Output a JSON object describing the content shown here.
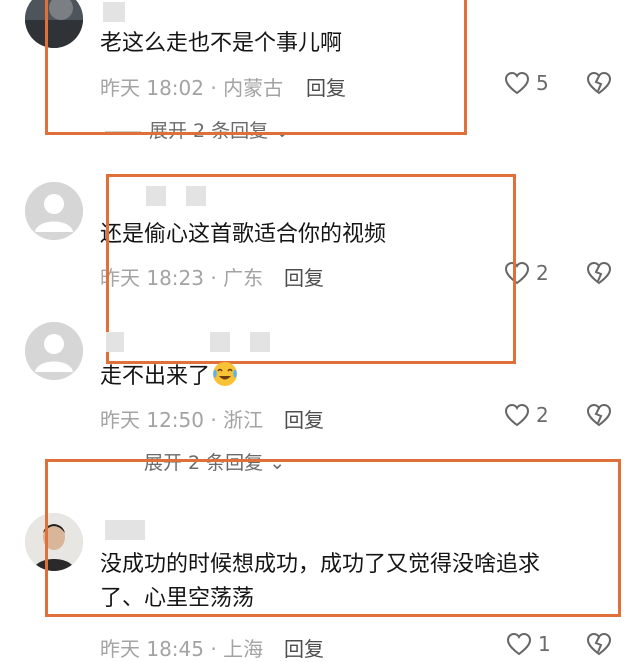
{
  "comments": [
    {
      "text": "老这么走也不是个事儿啊",
      "time": "昨天 18:02 · 内蒙古",
      "reply": "回复",
      "likes": "5",
      "expand": "展开 2 条回复"
    },
    {
      "text": "还是偷心这首歌适合你的视频",
      "time": "昨天 18:23 · 广东",
      "reply": "回复",
      "likes": "2"
    },
    {
      "text": "走不出来了",
      "emoji": "crying-laughing-emoji",
      "time": "昨天 12:50 · 浙江",
      "reply": "回复",
      "likes": "2",
      "expand": "展开 2 条回复"
    },
    {
      "text_line1": "没成功的时候想成功，成功了又觉得没啥追求",
      "text_line2": "了、心里空荡荡",
      "time": "昨天 18:45 · 上海",
      "reply": "回复",
      "likes": "1"
    }
  ],
  "colors": {
    "highlight_frame": "#e0703a",
    "meta_text": "#a3a3a3",
    "name_redaction": "#e3e3e3"
  },
  "icons": {
    "like": "heart-outline-icon",
    "dislike": "broken-heart-icon",
    "expand": "chevron-down-icon"
  }
}
